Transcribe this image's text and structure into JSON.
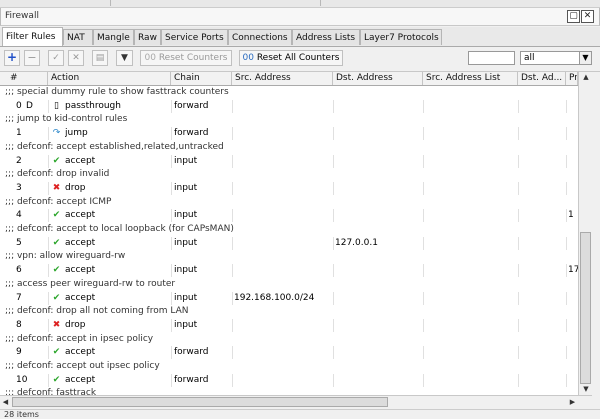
{
  "window": {
    "title": "Firewall",
    "restore_glyph": "▢",
    "close_glyph": "✕"
  },
  "tabs": [
    {
      "label": "Filter Rules",
      "active": true
    },
    {
      "label": "NAT"
    },
    {
      "label": "Mangle"
    },
    {
      "label": "Raw"
    },
    {
      "label": "Service Ports"
    },
    {
      "label": "Connections"
    },
    {
      "label": "Address Lists"
    },
    {
      "label": "Layer7 Protocols"
    }
  ],
  "toolbar": {
    "add_icon": "+",
    "remove_icon": "−",
    "enable_icon": "✓",
    "disable_icon": "✕",
    "comment_icon": "▤",
    "filter_icon": "▼",
    "reset_counters_label": "Reset Counters",
    "reset_all_counters_label": "Reset All Counters",
    "search_value": "",
    "filter_select_value": "all"
  },
  "columns": [
    "#",
    "Action",
    "Chain",
    "Src. Address",
    "Dst. Address",
    "Src. Address List",
    "Dst. Ad...",
    "Pr"
  ],
  "rows": [
    {
      "type": "comment",
      "text": ";;; special dummy rule to show fasttrack counters"
    },
    {
      "type": "rule",
      "num": "0",
      "flag": "D",
      "action": "passthrough",
      "icon": "passthrough",
      "chain": "forward",
      "src": "",
      "dst": "",
      "srclist": "",
      "dstlist": "",
      "proto": ""
    },
    {
      "type": "comment",
      "text": ";;; jump to kid-control rules"
    },
    {
      "type": "rule",
      "num": "1",
      "flag": "",
      "action": "jump",
      "icon": "jump",
      "chain": "forward",
      "src": "",
      "dst": "",
      "srclist": "",
      "dstlist": "",
      "proto": ""
    },
    {
      "type": "comment",
      "text": ";;; defconf: accept established,related,untracked"
    },
    {
      "type": "rule",
      "num": "2",
      "flag": "",
      "action": "accept",
      "icon": "accept",
      "chain": "input",
      "src": "",
      "dst": "",
      "srclist": "",
      "dstlist": "",
      "proto": ""
    },
    {
      "type": "comment",
      "text": ";;; defconf: drop invalid"
    },
    {
      "type": "rule",
      "num": "3",
      "flag": "",
      "action": "drop",
      "icon": "drop",
      "chain": "input",
      "src": "",
      "dst": "",
      "srclist": "",
      "dstlist": "",
      "proto": ""
    },
    {
      "type": "comment",
      "text": ";;; defconf: accept ICMP"
    },
    {
      "type": "rule",
      "num": "4",
      "flag": "",
      "action": "accept",
      "icon": "accept",
      "chain": "input",
      "src": "",
      "dst": "",
      "srclist": "",
      "dstlist": "",
      "proto": "1"
    },
    {
      "type": "comment",
      "text": ";;; defconf: accept to local loopback (for CAPsMAN)"
    },
    {
      "type": "rule",
      "num": "5",
      "flag": "",
      "action": "accept",
      "icon": "accept",
      "chain": "input",
      "src": "",
      "dst": "127.0.0.1",
      "srclist": "",
      "dstlist": "",
      "proto": ""
    },
    {
      "type": "comment",
      "text": ";;; vpn: allow wireguard-rw"
    },
    {
      "type": "rule",
      "num": "6",
      "flag": "",
      "action": "accept",
      "icon": "accept",
      "chain": "input",
      "src": "",
      "dst": "",
      "srclist": "",
      "dstlist": "",
      "proto": "17"
    },
    {
      "type": "comment",
      "text": ";;; access peer wireguard-rw to router"
    },
    {
      "type": "rule",
      "num": "7",
      "flag": "",
      "action": "accept",
      "icon": "accept",
      "chain": "input",
      "src": "192.168.100.0/24",
      "dst": "",
      "srclist": "",
      "dstlist": "",
      "proto": ""
    },
    {
      "type": "comment",
      "text": ";;; defconf: drop all not coming from LAN"
    },
    {
      "type": "rule",
      "num": "8",
      "flag": "",
      "action": "drop",
      "icon": "drop",
      "chain": "input",
      "src": "",
      "dst": "",
      "srclist": "",
      "dstlist": "",
      "proto": ""
    },
    {
      "type": "comment",
      "text": ";;; defconf: accept in ipsec policy"
    },
    {
      "type": "rule",
      "num": "9",
      "flag": "",
      "action": "accept",
      "icon": "accept",
      "chain": "forward",
      "src": "",
      "dst": "",
      "srclist": "",
      "dstlist": "",
      "proto": ""
    },
    {
      "type": "comment",
      "text": ";;; defconf: accept out ipsec policy"
    },
    {
      "type": "rule",
      "num": "10",
      "flag": "",
      "action": "accept",
      "icon": "accept",
      "chain": "forward",
      "src": "",
      "dst": "",
      "srclist": "",
      "dstlist": "",
      "proto": ""
    },
    {
      "type": "comment",
      "text": ";;; defconf: fasttrack"
    }
  ],
  "status": {
    "items_text": "28 items"
  },
  "icons": {
    "accept": "✔",
    "drop": "✖",
    "jump": "↷",
    "passthrough": "▯"
  },
  "colors": {
    "accept": "#2da62d",
    "drop": "#dd2222",
    "jump": "#2a86c9"
  }
}
